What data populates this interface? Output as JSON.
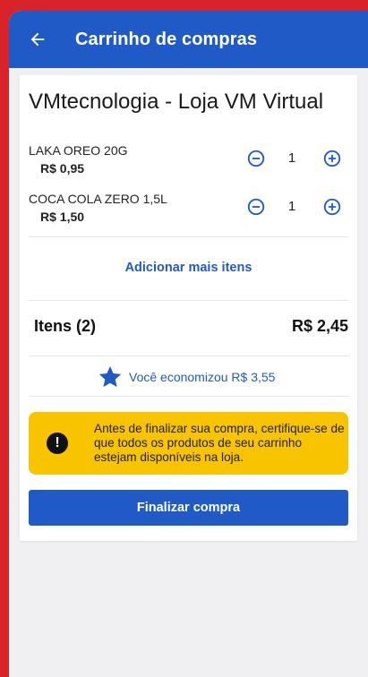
{
  "header": {
    "title": "Carrinho de compras",
    "back_icon": "arrow-left-icon"
  },
  "store": {
    "name": "VMtecnologia - Loja VM Virtual"
  },
  "items": [
    {
      "name": "LAKA OREO 20G",
      "price": "R$ 0,95",
      "quantity": "1"
    },
    {
      "name": "COCA COLA ZERO 1,5L",
      "price": "R$ 1,50",
      "quantity": "1"
    }
  ],
  "add_more_label": "Adicionar mais itens",
  "total": {
    "label": "Itens (2)",
    "value": "R$ 2,45"
  },
  "savings": {
    "text": "Você economizou R$ 3,55",
    "icon": "star-icon"
  },
  "warning": {
    "text": "Antes de finalizar sua compra, certifique-se de que todos os produtos de seu carrinho estejam disponíveis na loja.",
    "icon": "exclamation-icon"
  },
  "finalize_label": "Finalizar compra",
  "colors": {
    "primary": "#1f5ac7",
    "warning": "#f8c400",
    "frame": "#d8232a"
  }
}
